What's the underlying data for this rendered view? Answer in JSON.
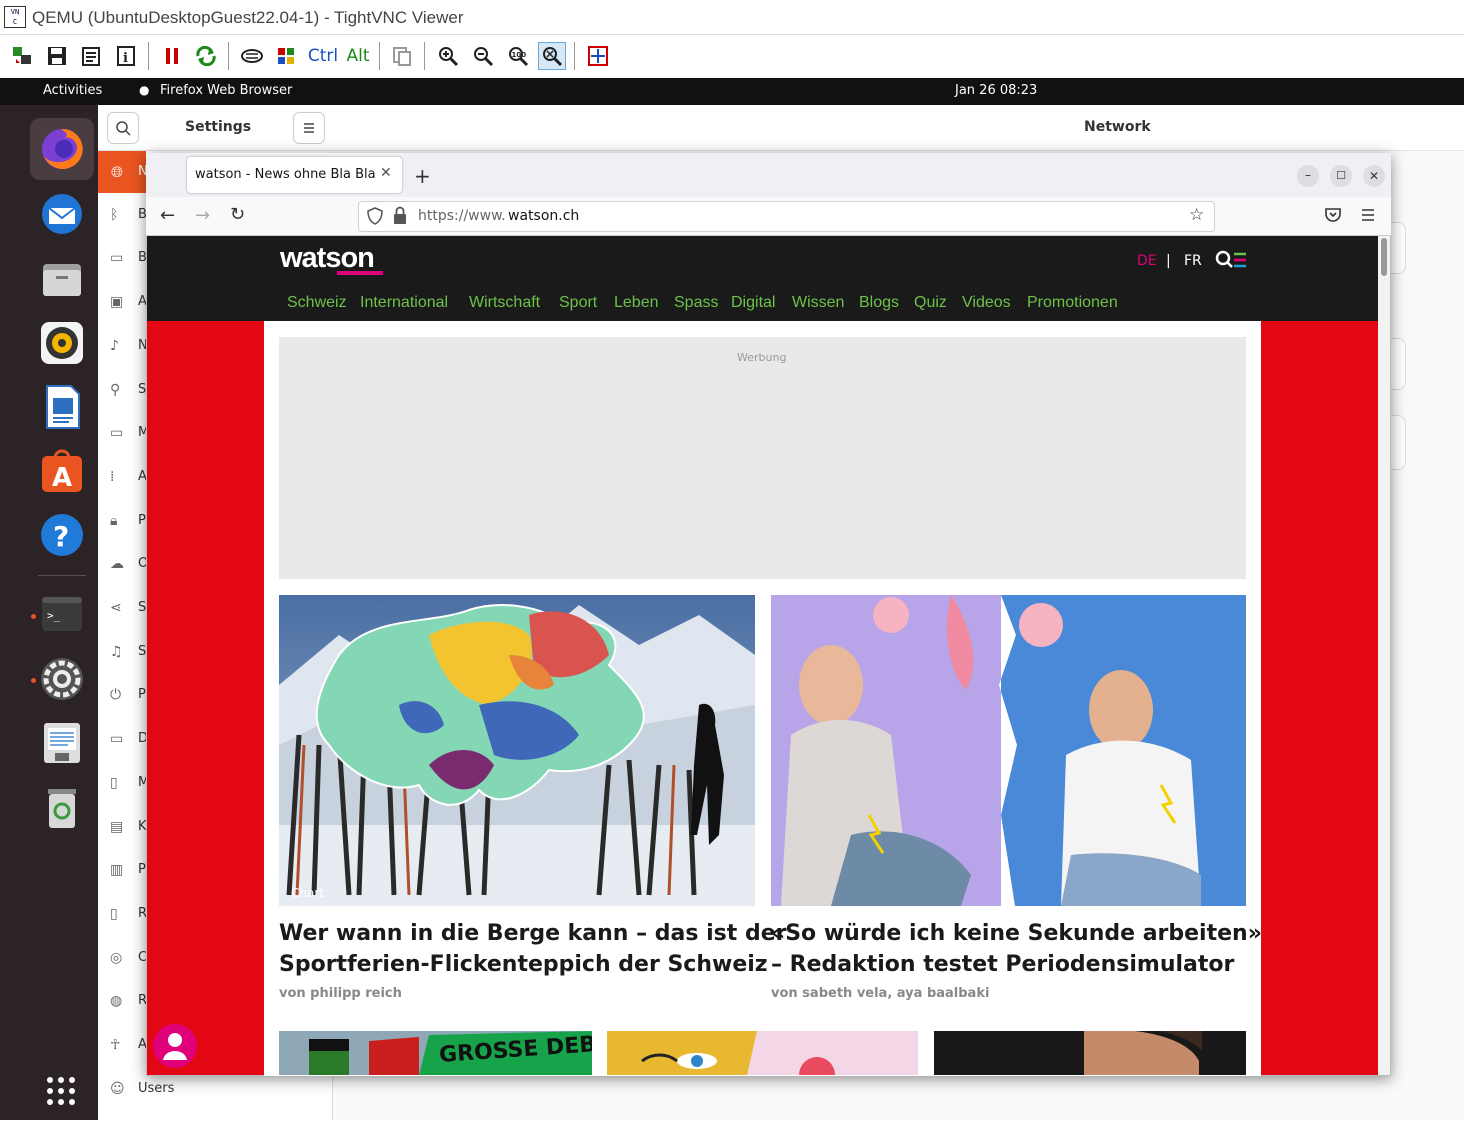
{
  "vnc": {
    "window_title": "QEMU (UbuntuDesktopGuest22.04-1) - TightVNC Viewer",
    "toolbar": {
      "ctrl_label": "Ctrl",
      "alt_label": "Alt"
    }
  },
  "topbar": {
    "activities": "Activities",
    "app_name": "Firefox Web Browser",
    "datetime": "Jan 26  08:23"
  },
  "dock": {
    "items": [
      "firefox",
      "thunderbird",
      "files",
      "rhythmbox",
      "libreoffice-writer",
      "ubuntu-software",
      "help",
      "terminal",
      "settings",
      "text-editor",
      "trash"
    ]
  },
  "settings": {
    "title": "Settings",
    "panel_title": "Network",
    "sidebar": [
      {
        "icon": "network-icon",
        "label": "N"
      },
      {
        "icon": "bluetooth-icon",
        "label": "B"
      },
      {
        "icon": "background-icon",
        "label": "B"
      },
      {
        "icon": "appearance-icon",
        "label": "A"
      },
      {
        "icon": "bell-icon",
        "label": "N"
      },
      {
        "icon": "search-icon",
        "label": "S"
      },
      {
        "icon": "multitasking-icon",
        "label": "M"
      },
      {
        "icon": "apps-icon",
        "label": "A"
      },
      {
        "icon": "lock-icon",
        "label": "P"
      },
      {
        "icon": "cloud-icon",
        "label": "O"
      },
      {
        "icon": "share-icon",
        "label": "S"
      },
      {
        "icon": "music-note-icon",
        "label": "S"
      },
      {
        "icon": "power-icon",
        "label": "P"
      },
      {
        "icon": "display-icon",
        "label": "D"
      },
      {
        "icon": "mouse-icon",
        "label": "M"
      },
      {
        "icon": "keyboard-icon",
        "label": "K"
      },
      {
        "icon": "printer-icon",
        "label": "P"
      },
      {
        "icon": "removable-media-icon",
        "label": "R"
      },
      {
        "icon": "color-icon",
        "label": "C"
      },
      {
        "icon": "globe-icon",
        "label": "R"
      },
      {
        "icon": "accessibility-icon",
        "label": "A"
      },
      {
        "icon": "users-icon",
        "label": "Users"
      }
    ]
  },
  "firefox": {
    "tab_title": "watson - News ohne Bla Bla",
    "url_prefix": "https://www.",
    "url_domain": "watson.ch"
  },
  "watson": {
    "logo": "watson",
    "lang_de": "DE",
    "lang_sep": "|",
    "lang_fr": "FR",
    "nav": [
      "Schweiz",
      "International",
      "Wirtschaft",
      "Sport",
      "Leben",
      "Spass",
      "Digital",
      "Wissen",
      "Blogs",
      "Quiz",
      "Videos",
      "Promotionen"
    ],
    "ad_label": "Werbung",
    "articles": [
      {
        "badge": "Chart",
        "headline_line1": "Wer wann in die Berge kann – das ist der",
        "headline_line2": "Sportferien-Flickenteppich der Schweiz",
        "byline": "von philipp reich"
      },
      {
        "headline_line1": "«So würde ich keine Sekunde arbeiten»",
        "headline_line2": "– Redaktion testet Periodensimulator",
        "byline": "von sabeth vela, aya baalbaki"
      }
    ],
    "teaser_text": "GROSSE DEBA"
  },
  "colors": {
    "watson_red": "#e30613",
    "watson_green": "#6cc24a",
    "watson_pink": "#e0007a",
    "ubuntu_orange": "#e95420"
  }
}
